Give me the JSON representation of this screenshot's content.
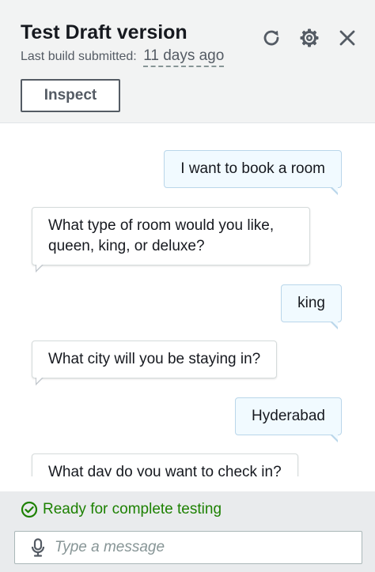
{
  "header": {
    "title": "Test Draft version",
    "build_label": "Last build submitted:",
    "build_value": "11 days ago",
    "inspect_label": "Inspect"
  },
  "icons": {
    "refresh": "refresh-icon",
    "settings": "gear-icon",
    "close": "close-icon",
    "status": "check-circle-icon",
    "mic": "microphone-icon"
  },
  "messages": [
    {
      "sender": "user",
      "text": "I want to book a room"
    },
    {
      "sender": "bot",
      "text": "What type of room would you like, queen, king, or deluxe?"
    },
    {
      "sender": "user",
      "text": "king"
    },
    {
      "sender": "bot",
      "text": "What city will you be staying in?"
    },
    {
      "sender": "user",
      "text": "Hyderabad"
    },
    {
      "sender": "bot",
      "text": "What day do you want to check in?"
    }
  ],
  "footer": {
    "status_text": "Ready for complete testing",
    "input_placeholder": "Type a message"
  },
  "colors": {
    "status_green": "#1d8102",
    "user_bubble": "#f1faff",
    "header_bg": "#f2f3f3"
  }
}
